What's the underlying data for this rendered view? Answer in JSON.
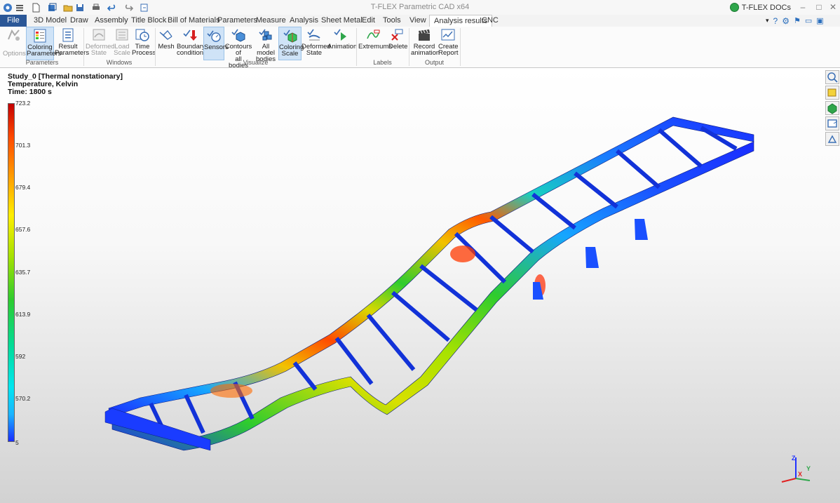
{
  "app": {
    "title": "T-FLEX Parametric CAD x64",
    "docs_label": "T-FLEX DOCs"
  },
  "tabs": [
    {
      "label": "File"
    },
    {
      "label": "3D Model"
    },
    {
      "label": "Draw"
    },
    {
      "label": "Assembly"
    },
    {
      "label": "Title Block"
    },
    {
      "label": "Bill of Materials"
    },
    {
      "label": "Parameters"
    },
    {
      "label": "Measure"
    },
    {
      "label": "Analysis"
    },
    {
      "label": "Sheet Metal"
    },
    {
      "label": "Edit"
    },
    {
      "label": "Tools"
    },
    {
      "label": "View"
    },
    {
      "label": "Analysis results"
    },
    {
      "label": "CNC"
    }
  ],
  "ribbon": {
    "parameters": {
      "label": "Parameters",
      "options": "Options",
      "coloring_1": "Coloring",
      "coloring_2": "Parameters",
      "result_1": "Result",
      "result_2": "Parameters"
    },
    "windows": {
      "label": "Windows",
      "deformed_1": "Deformed",
      "deformed_2": "State",
      "load_1": "Load",
      "load_2": "Scale",
      "time_1": "Time",
      "time_2": "Process"
    },
    "visualize": {
      "label": "Visualize",
      "mesh": "Mesh",
      "boundary_1": "Boundary",
      "boundary_2": "conditions",
      "sensors": "Sensors",
      "contours_1": "Contours of",
      "contours_2": "all bodies",
      "allmodel_1": "All model",
      "allmodel_2": "bodies",
      "colscale_1": "Coloring",
      "colscale_2": "Scale",
      "defstate_1": "Deformed",
      "defstate_2": "State",
      "animation": "Animation"
    },
    "labels": {
      "label": "Labels",
      "extremums": "Extremums",
      "delete": "Delete"
    },
    "output": {
      "label": "Output",
      "record_1": "Record",
      "record_2": "animation",
      "report_1": "Create",
      "report_2": "Report"
    }
  },
  "study": {
    "line1": "Study_0 [Thermal nonstationary]",
    "line2": "Temperature, Kelvin",
    "line3": "Time: 1800 s"
  },
  "scale": {
    "ticks": [
      "723.2",
      "701.3",
      "679.4",
      "657.6",
      "635.7",
      "613.9",
      "592",
      "570.2",
      "5"
    ]
  },
  "axes": {
    "z": "Z",
    "y": "Y",
    "x": "X"
  },
  "colors": {
    "file_tab": "#2b5797",
    "scale_max": "#c40000",
    "scale_min": "#1a2cff"
  }
}
